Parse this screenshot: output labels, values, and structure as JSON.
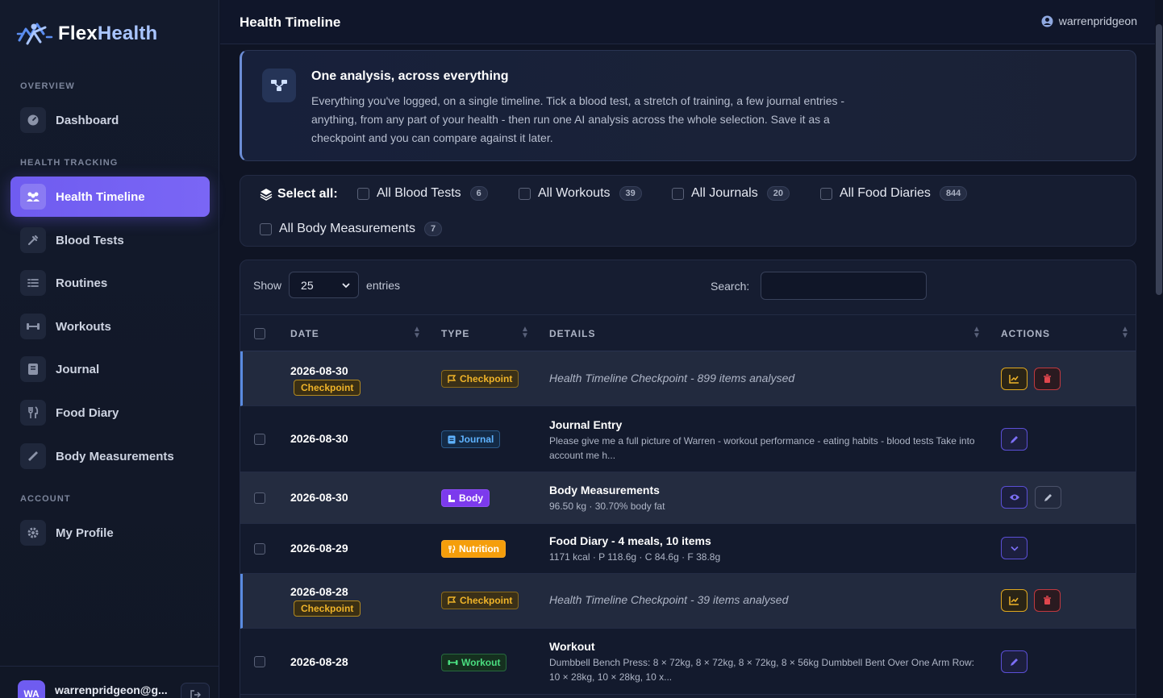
{
  "brand": {
    "part1": "Flex",
    "part2": "Health"
  },
  "sidebar": {
    "sections": {
      "overview": "OVERVIEW",
      "tracking": "HEALTH TRACKING",
      "account": "ACCOUNT"
    },
    "items": [
      {
        "label": "Dashboard",
        "icon": "gauge-icon"
      },
      {
        "label": "Health Timeline",
        "icon": "users-icon",
        "active": true
      },
      {
        "label": "Blood Tests",
        "icon": "syringe-icon"
      },
      {
        "label": "Routines",
        "icon": "list-icon"
      },
      {
        "label": "Workouts",
        "icon": "dumbbell-icon"
      },
      {
        "label": "Journal",
        "icon": "book-icon"
      },
      {
        "label": "Food Diary",
        "icon": "utensils-icon"
      },
      {
        "label": "Body Measurements",
        "icon": "ruler-icon"
      },
      {
        "label": "My Profile",
        "icon": "gear-icon"
      }
    ],
    "user": {
      "initials": "WA",
      "email": "warrenpridgeon@g..."
    }
  },
  "topbar": {
    "title": "Health Timeline",
    "username": "warrenpridgeon"
  },
  "info": {
    "title": "One analysis, across everything",
    "text": "Everything you've logged, on a single timeline. Tick a blood test, a stretch of training, a few journal entries - anything, from any part of your health - then run one AI analysis across the whole selection. Save it as a checkpoint and you can compare against it later."
  },
  "select_all": {
    "label": "Select all:",
    "options": [
      {
        "label": "All Blood Tests",
        "count": "6"
      },
      {
        "label": "All Workouts",
        "count": "39"
      },
      {
        "label": "All Journals",
        "count": "20"
      },
      {
        "label": "All Food Diaries",
        "count": "844"
      },
      {
        "label": "All Body Measurements",
        "count": "7"
      }
    ]
  },
  "table": {
    "show_label": "Show",
    "entries_value": "25",
    "entries_label": "entries",
    "search_label": "Search:",
    "columns": {
      "date": "DATE",
      "type": "TYPE",
      "details": "DETAILS",
      "actions": "ACTIONS"
    },
    "rows": [
      {
        "date": "2026-08-30",
        "tag": "Checkpoint",
        "type": "Checkpoint",
        "details": "Health Timeline Checkpoint - 899 items analysed"
      },
      {
        "date": "2026-08-30",
        "type": "Journal",
        "title": "Journal Entry",
        "sub": "Please give me a full picture of Warren - workout performance - eating habits - blood tests Take into account me h..."
      },
      {
        "date": "2026-08-30",
        "type": "Body",
        "title": "Body Measurements",
        "sub": "96.50 kg · 30.70% body fat"
      },
      {
        "date": "2026-08-29",
        "type": "Nutrition",
        "title": "Food Diary - 4 meals, 10 items",
        "sub": "1171 kcal · P 118.6g · C 84.6g · F 38.8g"
      },
      {
        "date": "2026-08-28",
        "tag": "Checkpoint",
        "type": "Checkpoint",
        "details": "Health Timeline Checkpoint - 39 items analysed"
      },
      {
        "date": "2026-08-28",
        "type": "Workout",
        "title": "Workout",
        "sub": "Dumbbell Bench Press: 8 × 72kg, 8 × 72kg, 8 × 72kg, 8 × 56kg Dumbbell Bent Over One Arm Row: 10 × 28kg, 10 × 28kg, 10 x..."
      }
    ]
  },
  "colors": {
    "accent": "#6f5cf0",
    "checkpoint": "#f0b429",
    "journal": "#5fb3ff",
    "body": "#7c3aed",
    "nutrition": "#f59e0b",
    "workout": "#4ade80",
    "danger": "#c0393f"
  }
}
